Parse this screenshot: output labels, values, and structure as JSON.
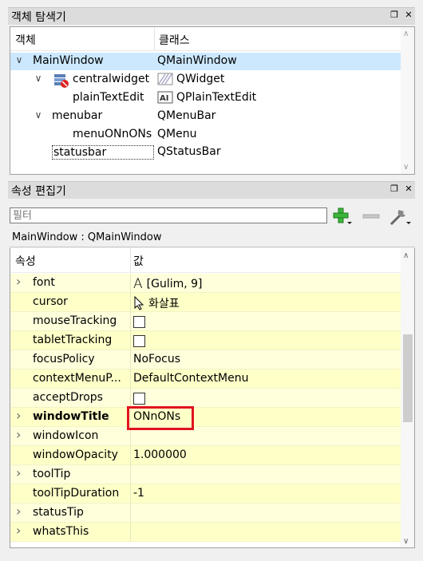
{
  "object_inspector": {
    "title": "객체 탐색기",
    "columns": [
      "객체",
      "클래스"
    ],
    "rows": [
      {
        "name": "MainWindow",
        "class": "QMainWindow"
      },
      {
        "name": "centralwidget",
        "class": "QWidget"
      },
      {
        "name": "plainTextEdit",
        "class": "QPlainTextEdit"
      },
      {
        "name": "menubar",
        "class": "QMenuBar"
      },
      {
        "name": "menuONnONs",
        "class": "QMenu"
      },
      {
        "name": "statusbar",
        "class": "QStatusBar"
      }
    ]
  },
  "property_editor": {
    "title": "속성 편집기",
    "filter_placeholder": "필터",
    "context": "MainWindow : QMainWindow",
    "columns": [
      "속성",
      "값"
    ],
    "rows": [
      {
        "name": "font",
        "value": "[Gulim, 9]",
        "expandable": true
      },
      {
        "name": "cursor",
        "value": "화살표"
      },
      {
        "name": "mouseTracking",
        "checked": false
      },
      {
        "name": "tabletTracking",
        "checked": false
      },
      {
        "name": "focusPolicy",
        "value": "NoFocus"
      },
      {
        "name": "contextMenuP...",
        "value": "DefaultContextMenu"
      },
      {
        "name": "acceptDrops",
        "checked": false
      },
      {
        "name": "windowTitle",
        "value": "ONnONs",
        "expandable": true,
        "bold": true
      },
      {
        "name": "windowIcon",
        "value": "",
        "expandable": true
      },
      {
        "name": "windowOpacity",
        "value": "1.000000"
      },
      {
        "name": "toolTip",
        "value": "",
        "expandable": true
      },
      {
        "name": "toolTipDuration",
        "value": "-1"
      },
      {
        "name": "statusTip",
        "value": "",
        "expandable": true
      },
      {
        "name": "whatsThis",
        "value": "",
        "expandable": true
      }
    ]
  },
  "colors": {
    "selection": "#cce8ff",
    "property_bg": "#ffffdc",
    "highlight": "#e0141e",
    "add_green": "#3cb43c"
  }
}
